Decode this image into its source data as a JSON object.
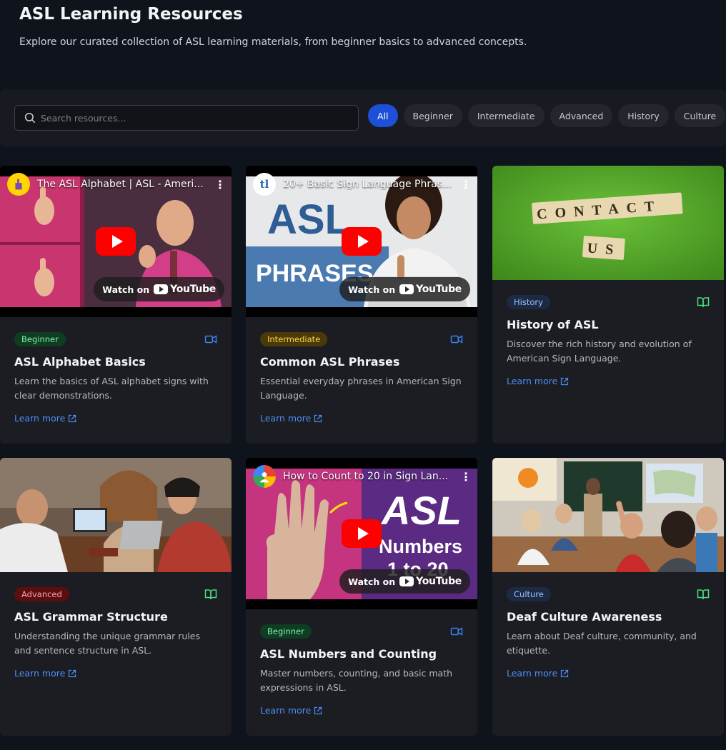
{
  "header": {
    "title": "ASL Learning Resources",
    "subtitle": "Explore our curated collection of ASL learning materials, from beginner basics to advanced concepts."
  },
  "search": {
    "placeholder": "Search resources...",
    "value": ""
  },
  "filters": [
    "All",
    "Beginner",
    "Intermediate",
    "Advanced",
    "History",
    "Culture"
  ],
  "active_filter": "All",
  "video_overlay": {
    "watch_on": "Watch on",
    "youtube": "YouTube"
  },
  "cards": [
    {
      "video_title": "The ASL Alphabet | ASL - Ameri...",
      "thumb_text": "",
      "badge": "Beginner",
      "type_icon": "video-icon",
      "title": "ASL Alphabet Basics",
      "description": "Learn the basics of ASL alphabet signs with clear demonstrations.",
      "link": "Learn more"
    },
    {
      "video_title": "20+ Basic Sign Language Phras...",
      "thumb_text": "ASL",
      "thumb_text_2": "PHRASES",
      "badge": "Intermediate",
      "type_icon": "video-icon",
      "title": "Common ASL Phrases",
      "description": "Essential everyday phrases in American Sign Language.",
      "link": "Learn more"
    },
    {
      "image_text": "CONTACT",
      "image_text_2": "US",
      "badge": "History",
      "type_icon": "book-icon",
      "title": "History of ASL",
      "description": "Discover the rich history and evolution of American Sign Language.",
      "link": "Learn more"
    },
    {
      "badge": "Advanced",
      "type_icon": "book-icon",
      "title": "ASL Grammar Structure",
      "description": "Understanding the unique grammar rules and sentence structure in ASL.",
      "link": "Learn more"
    },
    {
      "video_title": "How to Count to 20 in Sign Lan...",
      "thumb_text": "ASL",
      "thumb_text_2": "Numbers",
      "thumb_text_3": "1 to 20",
      "badge": "Beginner",
      "type_icon": "video-icon",
      "title": "ASL Numbers and Counting",
      "description": "Master numbers, counting, and basic math expressions in ASL.",
      "link": "Learn more"
    },
    {
      "badge": "Culture",
      "type_icon": "book-icon",
      "title": "Deaf Culture Awareness",
      "description": "Learn about Deaf culture, community, and etiquette.",
      "link": "Learn more"
    }
  ],
  "colors": {
    "background": "#0f131c",
    "card": "#1b1d22",
    "accent": "#1d4fd8",
    "link": "#4d8df7",
    "video_icon": "#3b82f6",
    "book_icon": "#4ade80"
  }
}
